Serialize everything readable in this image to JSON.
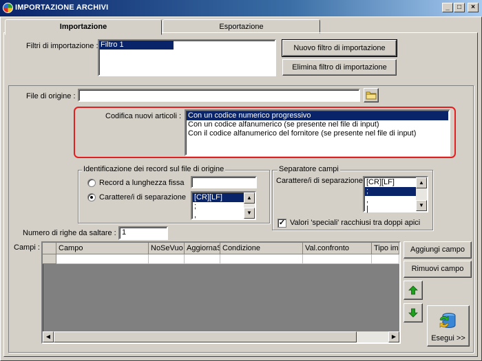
{
  "window": {
    "title": "IMPORTAZIONE ARCHIVI",
    "controls": {
      "minimize": "_",
      "maximize": "□",
      "close": "×"
    }
  },
  "tabs": [
    {
      "label": "Importazione",
      "active": true
    },
    {
      "label": "Esportazione",
      "active": false
    }
  ],
  "filters": {
    "label": "Filtri di importazione :",
    "items": [
      "Filtro 1"
    ],
    "new_button": "Nuovo filtro di importazione",
    "delete_button": "Elimina filtro di importazione"
  },
  "origin_file": {
    "label": "File di origine :",
    "value": ""
  },
  "encoding": {
    "label": "Codifica nuovi articoli :",
    "options": [
      "Con un codice numerico progressivo",
      "Con un codice alfanumerico (se presente nel file di input)",
      "Con il codice alfanumerico del fornitore (se presente nel file di input)"
    ],
    "selected_index": 0
  },
  "record_id": {
    "title": "Identificazione dei record sul file di origine",
    "fixed_length_label": "Record a lunghezza fissa",
    "fixed_length_value": "",
    "separator_label": "Carattere/i di separazione",
    "separator_items": [
      "[CR][LF]",
      ";",
      ","
    ],
    "selected_option": "separator"
  },
  "field_separator": {
    "title": "Separatore campi",
    "label": "Carattere/i di separazione",
    "items": [
      "[CR][LF]",
      ";",
      ",",
      "|"
    ],
    "selected_index": 1,
    "quotes_label": "Valori 'speciali' racchiusi tra doppi apici",
    "quotes_checked": true
  },
  "skip_rows": {
    "label": "Numero di righe da saltare :",
    "value": "1"
  },
  "fields": {
    "label": "Campi :",
    "columns": [
      "Campo",
      "NoSeVuo",
      "AggiornaS",
      "Condizione",
      "Val.confronto",
      "Tipo imp"
    ],
    "add_button": "Aggiungi campo",
    "remove_button": "Rimuovi campo",
    "execute_button": "Esegui >>"
  },
  "colors": {
    "title_start": "#0a246a",
    "title_end": "#a6caf0",
    "selection": "#0a246a",
    "highlight_border": "#e02020",
    "face": "#d4d0c8",
    "arrow_green": "#1ea01e"
  }
}
